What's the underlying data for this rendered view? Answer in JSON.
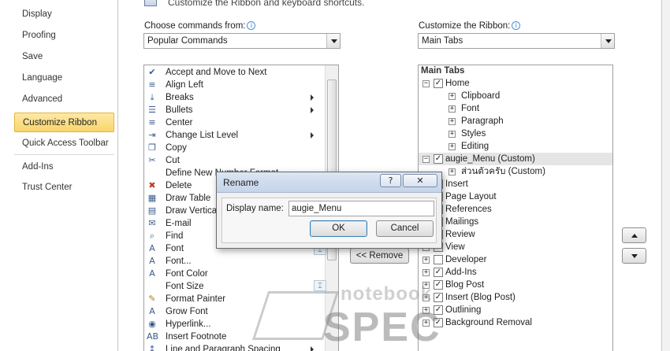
{
  "nav": {
    "items": [
      "Display",
      "Proofing",
      "Save",
      "Language",
      "Advanced",
      "Customize Ribbon",
      "Quick Access Toolbar",
      "Add-Ins",
      "Trust Center"
    ],
    "active": "Customize Ribbon"
  },
  "header": {
    "text": "Customize the Ribbon and keyboard shortcuts."
  },
  "commands": {
    "label": "Choose commands from:",
    "selected": "Popular Commands",
    "items": [
      {
        "label": "Accept and Move to Next",
        "icon": "accept-icon",
        "submenu": false
      },
      {
        "label": "Align Left",
        "icon": "align-left-icon",
        "submenu": false
      },
      {
        "label": "Breaks",
        "icon": "breaks-icon",
        "submenu": true
      },
      {
        "label": "Bullets",
        "icon": "bullets-icon",
        "submenu": true
      },
      {
        "label": "Center",
        "icon": "center-icon",
        "submenu": false
      },
      {
        "label": "Change List Level",
        "icon": "list-level-icon",
        "submenu": true
      },
      {
        "label": "Copy",
        "icon": "copy-icon",
        "submenu": false
      },
      {
        "label": "Cut",
        "icon": "cut-icon",
        "submenu": false
      },
      {
        "label": "Define New Number Format...",
        "icon": "",
        "submenu": false
      },
      {
        "label": "Delete",
        "icon": "delete-icon",
        "submenu": false
      },
      {
        "label": "Draw Table",
        "icon": "draw-table-icon",
        "submenu": false
      },
      {
        "label": "Draw Vertical Text Box",
        "icon": "text-box-icon",
        "submenu": false
      },
      {
        "label": "E-mail",
        "icon": "email-icon",
        "submenu": false
      },
      {
        "label": "Find",
        "icon": "find-icon",
        "submenu": false
      },
      {
        "label": "Font",
        "icon": "font-icon",
        "submenu": false
      },
      {
        "label": "Font...",
        "icon": "font-dialog-icon",
        "submenu": false
      },
      {
        "label": "Font Color",
        "icon": "font-color-icon",
        "submenu": false
      },
      {
        "label": "Font Size",
        "icon": "",
        "submenu": false
      },
      {
        "label": "Format Painter",
        "icon": "format-painter-icon",
        "submenu": false
      },
      {
        "label": "Grow Font",
        "icon": "grow-font-icon",
        "submenu": false
      },
      {
        "label": "Hyperlink...",
        "icon": "hyperlink-icon",
        "submenu": false
      },
      {
        "label": "Insert Footnote",
        "icon": "footnote-icon",
        "submenu": false
      },
      {
        "label": "Line and Paragraph Spacing",
        "icon": "spacing-icon",
        "submenu": true
      }
    ]
  },
  "ribbon": {
    "label": "Customize the Ribbon:",
    "selected": "Main Tabs",
    "tree_header": "Main Tabs",
    "rows": [
      {
        "label": "Home",
        "level": 0,
        "expander": "−",
        "checked": true,
        "selected": false
      },
      {
        "label": "Clipboard",
        "level": 1,
        "expander": "+",
        "checked": null,
        "selected": false
      },
      {
        "label": "Font",
        "level": 1,
        "expander": "+",
        "checked": null,
        "selected": false
      },
      {
        "label": "Paragraph",
        "level": 1,
        "expander": "+",
        "checked": null,
        "selected": false
      },
      {
        "label": "Styles",
        "level": 1,
        "expander": "+",
        "checked": null,
        "selected": false
      },
      {
        "label": "Editing",
        "level": 1,
        "expander": "+",
        "checked": null,
        "selected": false
      },
      {
        "label": "augie_Menu (Custom)",
        "level": 0,
        "expander": "−",
        "checked": true,
        "selected": true
      },
      {
        "label": "ส่วนตัวครับ (Custom)",
        "level": 1,
        "expander": "+",
        "checked": null,
        "selected": false
      },
      {
        "label": "Insert",
        "level": 0,
        "expander": "+",
        "checked": true,
        "selected": false
      },
      {
        "label": "Page Layout",
        "level": 0,
        "expander": "+",
        "checked": true,
        "selected": false
      },
      {
        "label": "References",
        "level": 0,
        "expander": "+",
        "checked": true,
        "selected": false
      },
      {
        "label": "Mailings",
        "level": 0,
        "expander": "+",
        "checked": true,
        "selected": false
      },
      {
        "label": "Review",
        "level": 0,
        "expander": "+",
        "checked": true,
        "selected": false
      },
      {
        "label": "View",
        "level": 0,
        "expander": "+",
        "checked": true,
        "selected": false
      },
      {
        "label": "Developer",
        "level": 0,
        "expander": "+",
        "checked": false,
        "selected": false
      },
      {
        "label": "Add-Ins",
        "level": 0,
        "expander": "+",
        "checked": true,
        "selected": false
      },
      {
        "label": "Blog Post",
        "level": 0,
        "expander": "+",
        "checked": true,
        "selected": false
      },
      {
        "label": "Insert (Blog Post)",
        "level": 0,
        "expander": "+",
        "checked": true,
        "selected": false
      },
      {
        "label": "Outlining",
        "level": 0,
        "expander": "+",
        "checked": true,
        "selected": false
      },
      {
        "label": "Background Removal",
        "level": 0,
        "expander": "+",
        "checked": true,
        "selected": false
      }
    ]
  },
  "buttons": {
    "remove": "<< Remove"
  },
  "dialog": {
    "title": "Rename",
    "help": "?",
    "close": "✕",
    "field_label": "Display name:",
    "field_value": "augie_Menu",
    "ok": "OK",
    "cancel": "Cancel"
  },
  "watermark": {
    "line1": "notebook",
    "line2": "SPEC"
  }
}
